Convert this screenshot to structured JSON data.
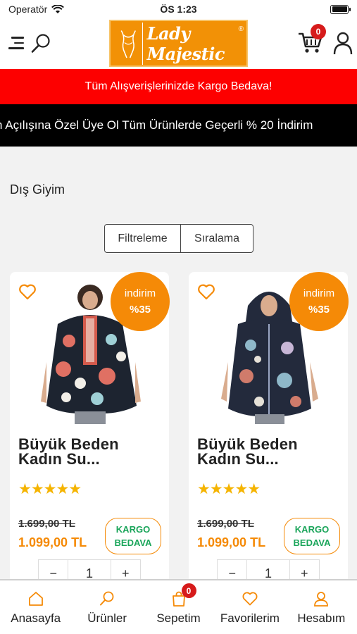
{
  "status_bar": {
    "carrier": "Operatör",
    "time": "ÖS 1:23"
  },
  "header": {
    "logo_text": "Lady Majestic",
    "logo_mark": "®",
    "cart_count": "0",
    "accent": "#f29106"
  },
  "promo_banner": {
    "text": "Tüm Alışverişlerinizde Kargo Bedava!",
    "color": "#fd0000"
  },
  "ticker": {
    "text": "n Açılışına Özel Üye Ol Tüm Ürünlerde Geçerli % 20 İndirim"
  },
  "category": {
    "title": "Dış Giyim"
  },
  "filters": {
    "filter_label": "Filtreleme",
    "sort_label": "Sıralama"
  },
  "products": [
    {
      "name": "Büyük Beden Kadın Su...",
      "badge_label": "indirim",
      "badge_percent": "%35",
      "stars": "★★★★★",
      "rating": 5,
      "old_price": "1.699,00 TL",
      "new_price": "1.099,00 TL",
      "shipping_line1": "KARGO",
      "shipping_line2": "BEDAVA",
      "minus": "−",
      "quantity": "1",
      "plus": "+"
    },
    {
      "name": "Büyük Beden Kadın Su...",
      "badge_label": "indirim",
      "badge_percent": "%35",
      "stars": "★★★★★",
      "rating": 5,
      "old_price": "1.699,00 TL",
      "new_price": "1.099,00 TL",
      "shipping_line1": "KARGO",
      "shipping_line2": "BEDAVA",
      "minus": "−",
      "quantity": "1",
      "plus": "+"
    }
  ],
  "tabbar": {
    "home": "Anasayfa",
    "products": "Ürünler",
    "cart": "Sepetim",
    "cart_count": "0",
    "favorites": "Favorilerim",
    "account": "Hesabım",
    "accent": "#f58a07"
  }
}
